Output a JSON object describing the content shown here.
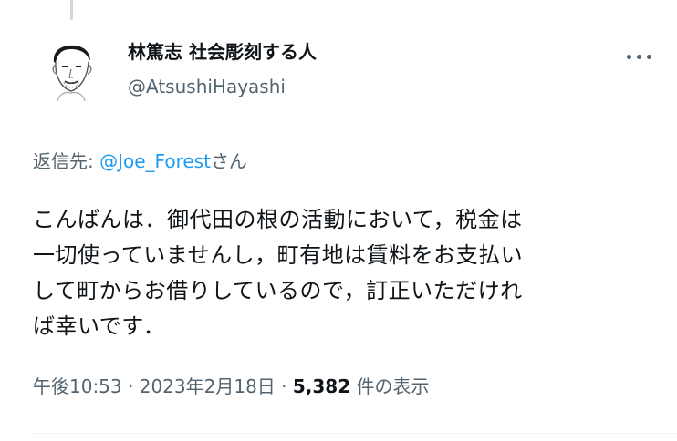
{
  "author": {
    "name": "林篤志 社会彫刻する人",
    "handle": "@AtsushiHayashi"
  },
  "reply_to": {
    "prefix": "返信先: ",
    "mention": "@Joe_Forest",
    "suffix": "さん"
  },
  "tweet": {
    "lines": [
      "こんばんは．御代田の根の活動において，税金は",
      "一切使っていませんし，町有地は賃料をお支払い",
      "して町からお借りしているので，訂正いただけれ",
      "ば幸いです．"
    ]
  },
  "meta": {
    "time": "午後10:53",
    "separator": " · ",
    "date": "2023年2月18日",
    "views_count": "5,382",
    "views_label": " 件の表示"
  },
  "icons": {
    "avatar": "user-avatar-sketch",
    "more": "more-horizontal-icon"
  },
  "colors": {
    "text": "#0f1419",
    "secondary": "#536471",
    "link": "#1d9bf0"
  }
}
